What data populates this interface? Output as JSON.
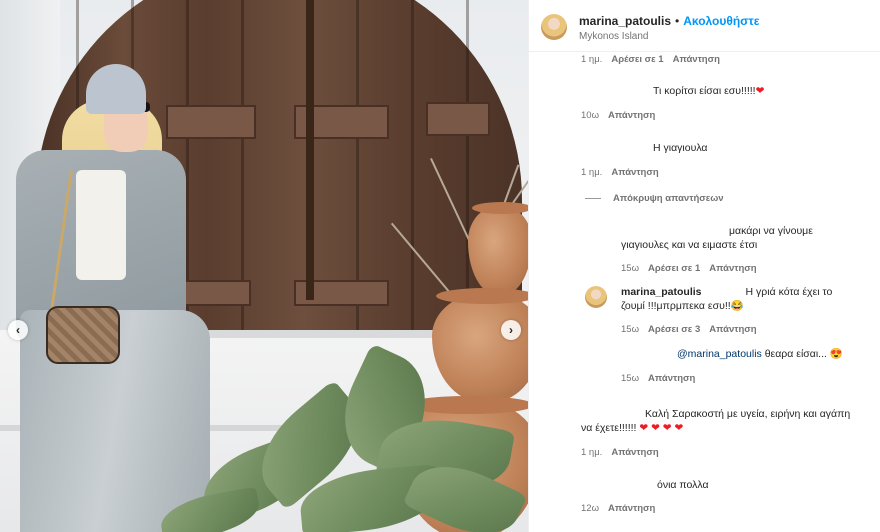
{
  "header": {
    "username": "marina_patoulis",
    "separator": "•",
    "follow_label": "Ακολουθήστε",
    "location": "Mykonos Island"
  },
  "carousel": {
    "prev_icon": "‹",
    "next_icon": "›"
  },
  "comments": {
    "c0": {
      "time": "1 ημ.",
      "likes": "Αρέσει σε 1",
      "reply": "Απάντηση"
    },
    "c1": {
      "text": "Τι κορίτσι είσαι εσυ!!!!!",
      "emoji": "❤",
      "time": "10ω",
      "reply": "Απάντηση"
    },
    "c2": {
      "text": "Η γιαγιουλα",
      "time": "1 ημ.",
      "reply": "Απάντηση"
    },
    "hide_replies": "Απόκρυψη απαντήσεων",
    "r1": {
      "text_line1": "μακάρι να γίνουμε",
      "text_line2": "γιαγιουλες και να ειμαστε έτσι",
      "time": "15ω",
      "likes": "Αρέσει σε 1",
      "reply": "Απάντηση"
    },
    "r2": {
      "username": "marina_patoulis",
      "text_line1": "Η γριά κότα έχει το",
      "text_line2": "ζουμί !!!μπρμπεκα εσυ!!",
      "emoji": "😂",
      "time": "15ω",
      "likes": "Αρέσει σε 3",
      "reply": "Απάντηση"
    },
    "r3": {
      "mention": "@marina_patoulis",
      "text": "θεαρα είσαι...",
      "emoji": "😍",
      "time": "15ω",
      "reply": "Απάντηση"
    },
    "c3": {
      "text_line1": "Καλή Σαρακοστή με υγεία, ειρήνη και αγάπη",
      "text_line2": "να έχετε!!!!!!",
      "emoji": "❤ ❤ ❤ ❤",
      "time": "1 ημ.",
      "reply": "Απάντηση"
    },
    "c4": {
      "text": "όνια πολλα",
      "time": "12ω",
      "reply": "Απάντηση"
    }
  },
  "colors": {
    "link_blue": "#0095f6",
    "text": "#262626",
    "muted": "#737373",
    "heart": "#ed1c24"
  }
}
